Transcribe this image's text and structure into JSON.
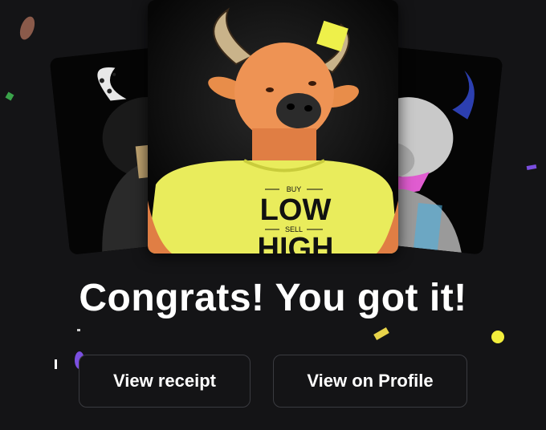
{
  "nft": {
    "shirt_text_small_top": "BUY",
    "shirt_text_large_top": "LOW",
    "shirt_text_small_bottom": "SELL",
    "shirt_text_large_bottom": "HIGH"
  },
  "headline": "Congrats! You got it!",
  "actions": {
    "view_receipt": "View receipt",
    "view_on_profile": "View on Profile"
  },
  "colors": {
    "background": "#141416",
    "button_border": "#3a3b40",
    "shirt": "#e9ec5c",
    "confetti_yellow": "#f2ee3c",
    "confetti_purple": "#7b4fe0",
    "confetti_blue": "#3fa0e6",
    "confetti_brown": "#8a5a4a"
  }
}
